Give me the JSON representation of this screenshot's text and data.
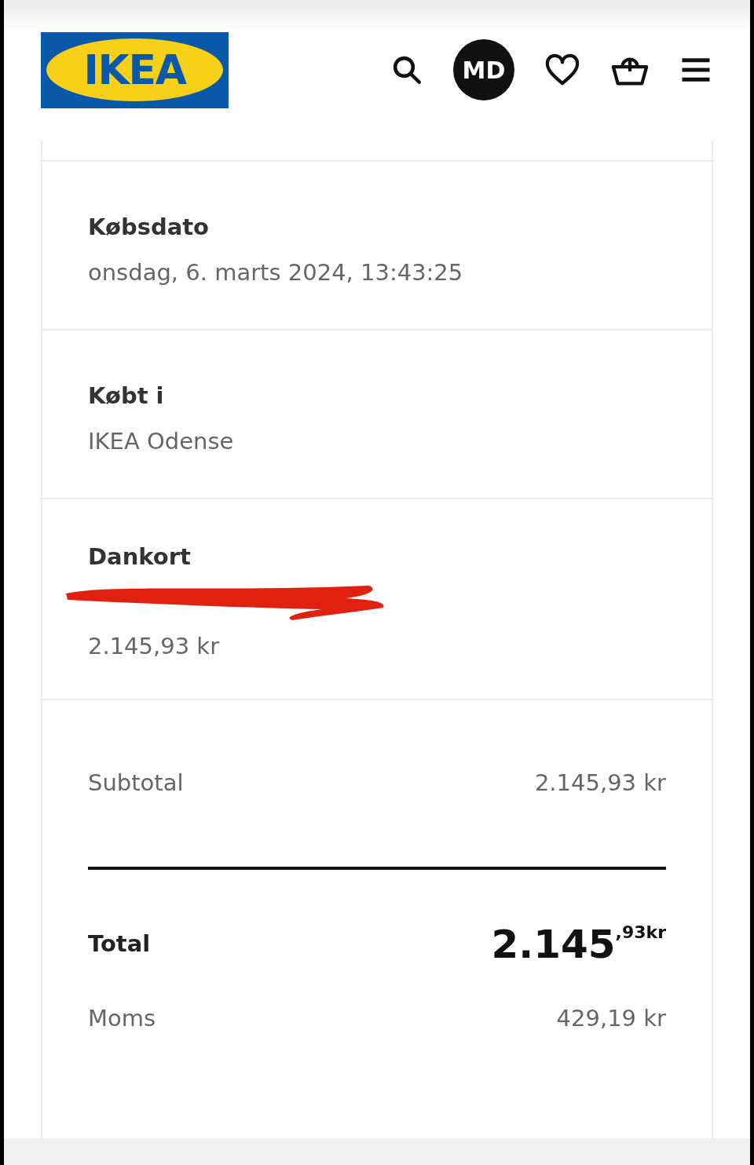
{
  "header": {
    "logo": "IKEA",
    "avatar": "MD"
  },
  "details": [
    {
      "label": "Købsdato",
      "value": "onsdag, 6. marts 2024, 13:43:25"
    },
    {
      "label": "Købt i",
      "value": "IKEA Odense"
    }
  ],
  "payment": {
    "label": "Dankort",
    "redacted": true,
    "amount": "2.145,93 kr"
  },
  "subtotal": {
    "label": "Subtotal",
    "value": "2.145,93 kr"
  },
  "total": {
    "label": "Total",
    "value": "2.145$^{,93kr}$"
  },
  "vat": {
    "label": "Moms",
    "value": "429,19 kr"
  }
}
